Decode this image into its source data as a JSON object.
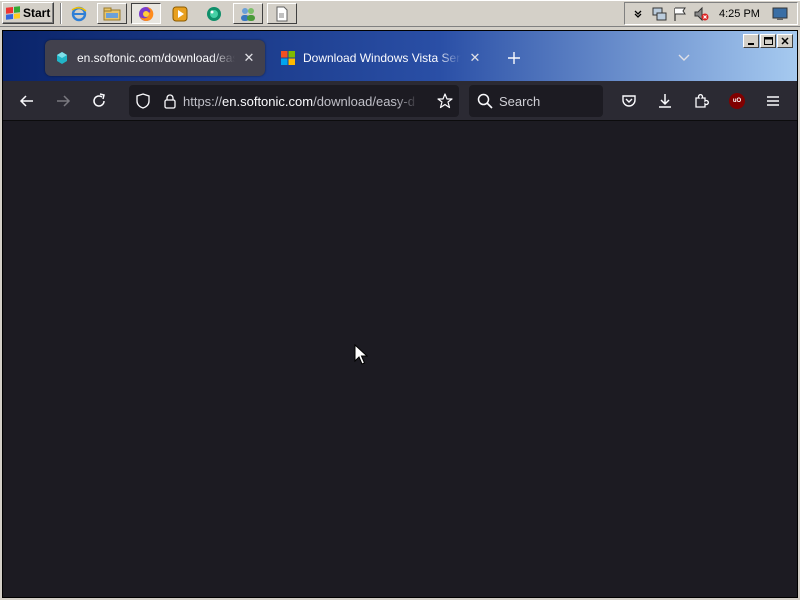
{
  "taskbar": {
    "start_label": "Start",
    "clock": "4:25 PM",
    "quick_launch": [
      {
        "name": "internet-explorer-icon",
        "color": "#3b82d6"
      },
      {
        "name": "file-explorer-icon",
        "color": "#d9b45a"
      },
      {
        "name": "firefox-icon",
        "color": "#ff7a1a"
      },
      {
        "name": "media-player-icon",
        "color": "#f0a020"
      },
      {
        "name": "browser-globe-icon",
        "color": "#1a9e7a"
      },
      {
        "name": "users-icon",
        "color": "#4a8fd0"
      },
      {
        "name": "document-icon",
        "color": "#f5f5f5"
      }
    ]
  },
  "browser": {
    "tabs": [
      {
        "title": "en.softonic.com/download/easy-d",
        "favicon": "softonic-icon",
        "active": true
      },
      {
        "title": "Download Windows Vista Service P",
        "favicon": "windows-logo-icon",
        "active": false
      }
    ],
    "url_host": "en.softonic.com",
    "url_prefix": "https://",
    "url_path": "/download/easy-d",
    "search_placeholder": "Search",
    "colors": {
      "toolbar": "#2b2a33",
      "content": "#1c1b22",
      "active_tab": "#42414d"
    }
  }
}
